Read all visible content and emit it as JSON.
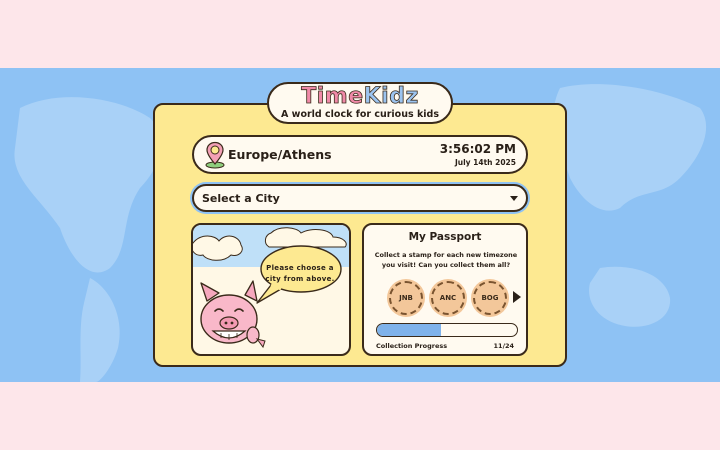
{
  "app": {
    "logo_part1": "Time",
    "logo_part2": "Kidz",
    "tagline": "A world clock for curious kids"
  },
  "location": {
    "timezone": "Europe/Athens",
    "time": "3:56:02 PM",
    "date": "July 14th 2025",
    "icon": "map-pin-icon"
  },
  "city_select": {
    "selected": "Select a City"
  },
  "mascot": {
    "message": "Please choose a city from above."
  },
  "passport": {
    "title": "My Passport",
    "description": "Collect a stamp for each new timezone you visit! Can you collect them all?",
    "stamps": [
      "JNB",
      "ANC",
      "BOG"
    ],
    "progress_label": "Collection Progress",
    "progress_count": "11/24",
    "progress_fraction": 0.4583
  },
  "colors": {
    "map_blue": "#8ec2f4",
    "card_yellow": "#fde991",
    "page_pink": "#fde6ea",
    "progress_blue": "#7fb2ea"
  }
}
